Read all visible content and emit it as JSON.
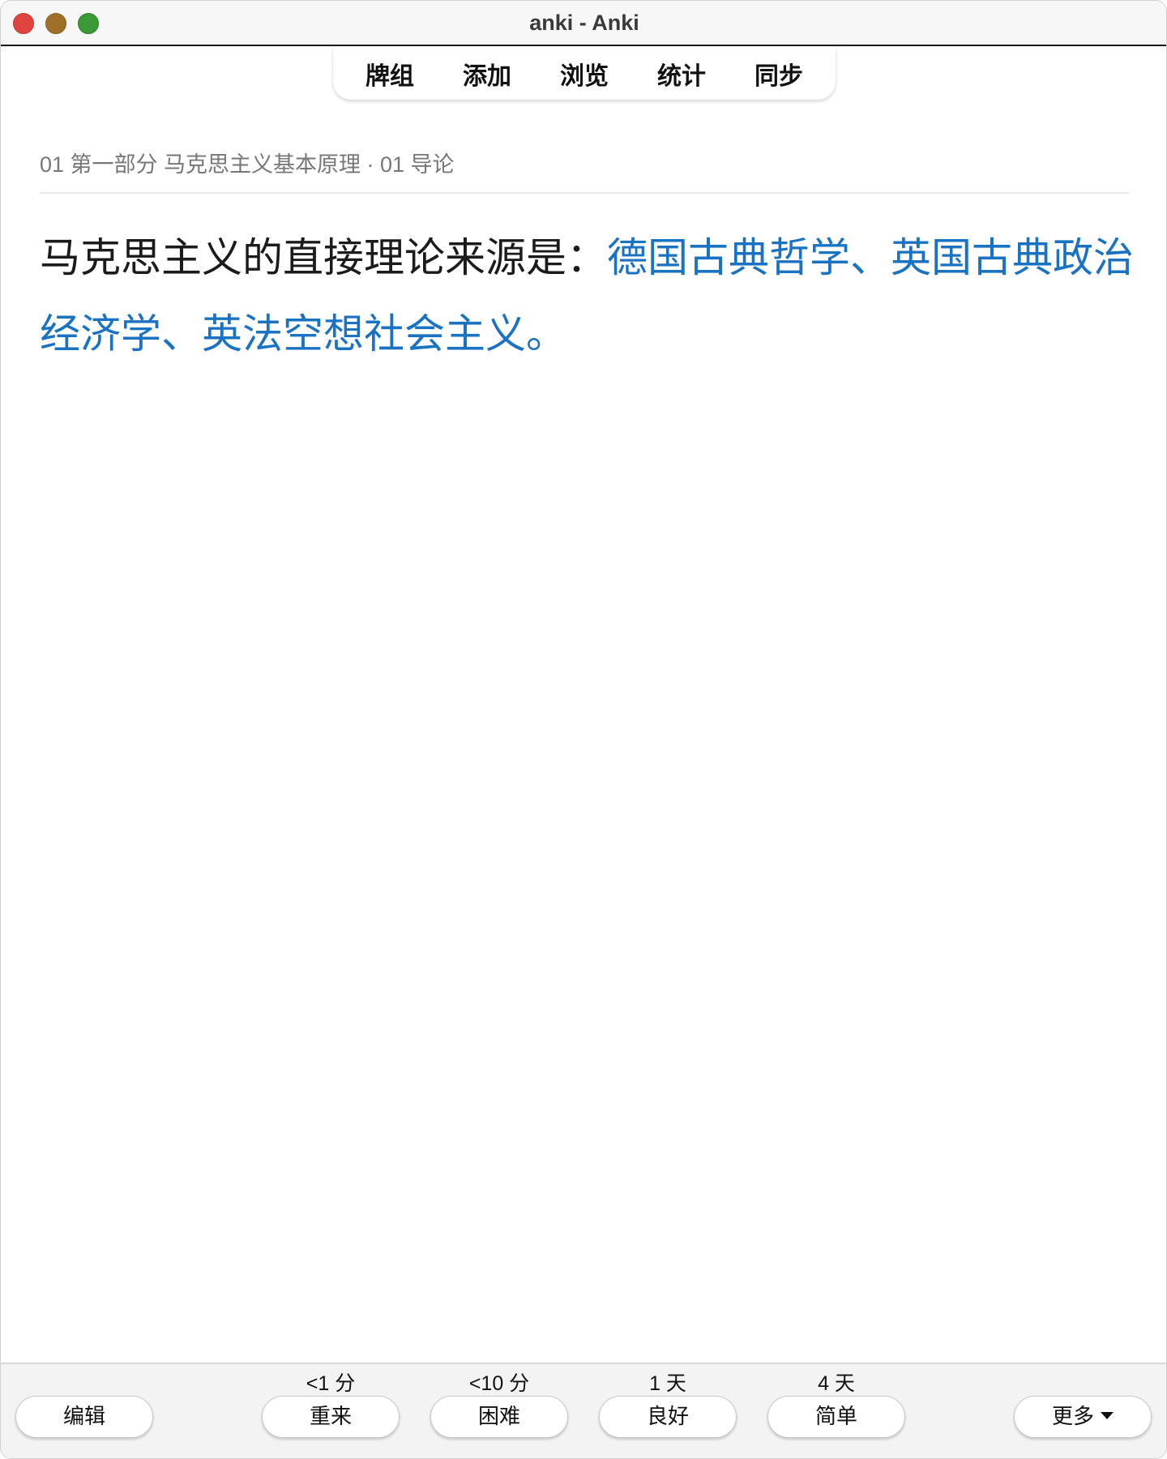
{
  "window": {
    "title": "anki - Anki"
  },
  "toolbar": {
    "items": [
      "牌组",
      "添加",
      "浏览",
      "统计",
      "同步"
    ]
  },
  "card": {
    "deck_path": "01 第一部分 马克思主义基本原理 · 01 导论",
    "question": "马克思主义的直接理论来源是：",
    "answer": "德国古典哲学、英国古典政治经济学、英法空想社会主义。"
  },
  "answer_buttons": [
    {
      "label": "重来",
      "due": "<1 分"
    },
    {
      "label": "困难",
      "due": "<10 分"
    },
    {
      "label": "良好",
      "due": "1 天"
    },
    {
      "label": "简单",
      "due": "4 天"
    }
  ],
  "bottom": {
    "edit_label": "编辑",
    "more_label": "更多"
  },
  "colors": {
    "answer_text": "#1a72c2",
    "close": "#e0443e",
    "minimize": "#a0702a",
    "maximize": "#3b9a36"
  }
}
